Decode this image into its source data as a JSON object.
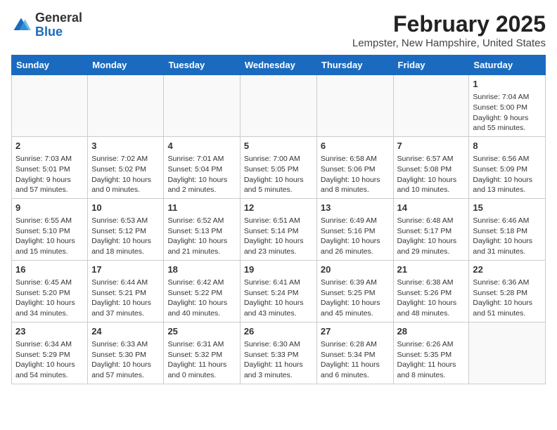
{
  "logo": {
    "general": "General",
    "blue": "Blue"
  },
  "title": "February 2025",
  "subtitle": "Lempster, New Hampshire, United States",
  "days_of_week": [
    "Sunday",
    "Monday",
    "Tuesday",
    "Wednesday",
    "Thursday",
    "Friday",
    "Saturday"
  ],
  "weeks": [
    [
      {
        "day": "",
        "content": ""
      },
      {
        "day": "",
        "content": ""
      },
      {
        "day": "",
        "content": ""
      },
      {
        "day": "",
        "content": ""
      },
      {
        "day": "",
        "content": ""
      },
      {
        "day": "",
        "content": ""
      },
      {
        "day": "1",
        "content": "Sunrise: 7:04 AM\nSunset: 5:00 PM\nDaylight: 9 hours and 55 minutes."
      }
    ],
    [
      {
        "day": "2",
        "content": "Sunrise: 7:03 AM\nSunset: 5:01 PM\nDaylight: 9 hours and 57 minutes."
      },
      {
        "day": "3",
        "content": "Sunrise: 7:02 AM\nSunset: 5:02 PM\nDaylight: 10 hours and 0 minutes."
      },
      {
        "day": "4",
        "content": "Sunrise: 7:01 AM\nSunset: 5:04 PM\nDaylight: 10 hours and 2 minutes."
      },
      {
        "day": "5",
        "content": "Sunrise: 7:00 AM\nSunset: 5:05 PM\nDaylight: 10 hours and 5 minutes."
      },
      {
        "day": "6",
        "content": "Sunrise: 6:58 AM\nSunset: 5:06 PM\nDaylight: 10 hours and 8 minutes."
      },
      {
        "day": "7",
        "content": "Sunrise: 6:57 AM\nSunset: 5:08 PM\nDaylight: 10 hours and 10 minutes."
      },
      {
        "day": "8",
        "content": "Sunrise: 6:56 AM\nSunset: 5:09 PM\nDaylight: 10 hours and 13 minutes."
      }
    ],
    [
      {
        "day": "9",
        "content": "Sunrise: 6:55 AM\nSunset: 5:10 PM\nDaylight: 10 hours and 15 minutes."
      },
      {
        "day": "10",
        "content": "Sunrise: 6:53 AM\nSunset: 5:12 PM\nDaylight: 10 hours and 18 minutes."
      },
      {
        "day": "11",
        "content": "Sunrise: 6:52 AM\nSunset: 5:13 PM\nDaylight: 10 hours and 21 minutes."
      },
      {
        "day": "12",
        "content": "Sunrise: 6:51 AM\nSunset: 5:14 PM\nDaylight: 10 hours and 23 minutes."
      },
      {
        "day": "13",
        "content": "Sunrise: 6:49 AM\nSunset: 5:16 PM\nDaylight: 10 hours and 26 minutes."
      },
      {
        "day": "14",
        "content": "Sunrise: 6:48 AM\nSunset: 5:17 PM\nDaylight: 10 hours and 29 minutes."
      },
      {
        "day": "15",
        "content": "Sunrise: 6:46 AM\nSunset: 5:18 PM\nDaylight: 10 hours and 31 minutes."
      }
    ],
    [
      {
        "day": "16",
        "content": "Sunrise: 6:45 AM\nSunset: 5:20 PM\nDaylight: 10 hours and 34 minutes."
      },
      {
        "day": "17",
        "content": "Sunrise: 6:44 AM\nSunset: 5:21 PM\nDaylight: 10 hours and 37 minutes."
      },
      {
        "day": "18",
        "content": "Sunrise: 6:42 AM\nSunset: 5:22 PM\nDaylight: 10 hours and 40 minutes."
      },
      {
        "day": "19",
        "content": "Sunrise: 6:41 AM\nSunset: 5:24 PM\nDaylight: 10 hours and 43 minutes."
      },
      {
        "day": "20",
        "content": "Sunrise: 6:39 AM\nSunset: 5:25 PM\nDaylight: 10 hours and 45 minutes."
      },
      {
        "day": "21",
        "content": "Sunrise: 6:38 AM\nSunset: 5:26 PM\nDaylight: 10 hours and 48 minutes."
      },
      {
        "day": "22",
        "content": "Sunrise: 6:36 AM\nSunset: 5:28 PM\nDaylight: 10 hours and 51 minutes."
      }
    ],
    [
      {
        "day": "23",
        "content": "Sunrise: 6:34 AM\nSunset: 5:29 PM\nDaylight: 10 hours and 54 minutes."
      },
      {
        "day": "24",
        "content": "Sunrise: 6:33 AM\nSunset: 5:30 PM\nDaylight: 10 hours and 57 minutes."
      },
      {
        "day": "25",
        "content": "Sunrise: 6:31 AM\nSunset: 5:32 PM\nDaylight: 11 hours and 0 minutes."
      },
      {
        "day": "26",
        "content": "Sunrise: 6:30 AM\nSunset: 5:33 PM\nDaylight: 11 hours and 3 minutes."
      },
      {
        "day": "27",
        "content": "Sunrise: 6:28 AM\nSunset: 5:34 PM\nDaylight: 11 hours and 6 minutes."
      },
      {
        "day": "28",
        "content": "Sunrise: 6:26 AM\nSunset: 5:35 PM\nDaylight: 11 hours and 8 minutes."
      },
      {
        "day": "",
        "content": ""
      }
    ]
  ]
}
